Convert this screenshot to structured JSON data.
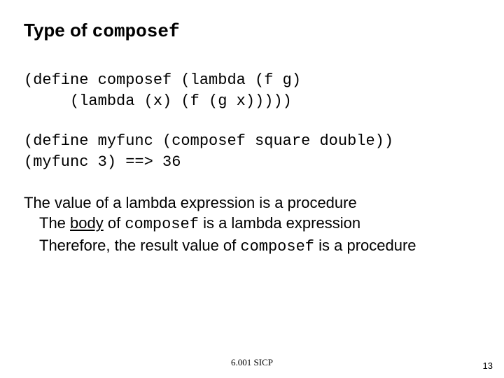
{
  "title": {
    "prefix": "Type of ",
    "mono": "composef"
  },
  "code": {
    "line1": "(define composef (lambda (f g)",
    "line2": "     (lambda (x) (f (g x)))))",
    "line3": "(define myfunc (composef square double))",
    "line4": "(myfunc 3) ==> 36"
  },
  "explain": {
    "l1": "The value of a lambda expression is a procedure",
    "l2a": "The ",
    "l2b": "body",
    "l2c": " of ",
    "l2mono": "composef",
    "l2d": " is a lambda expression",
    "l3a": "Therefore, the result value of ",
    "l3mono": "composef",
    "l3b": " is a procedure"
  },
  "footer": "6.001 SICP",
  "page": "13"
}
